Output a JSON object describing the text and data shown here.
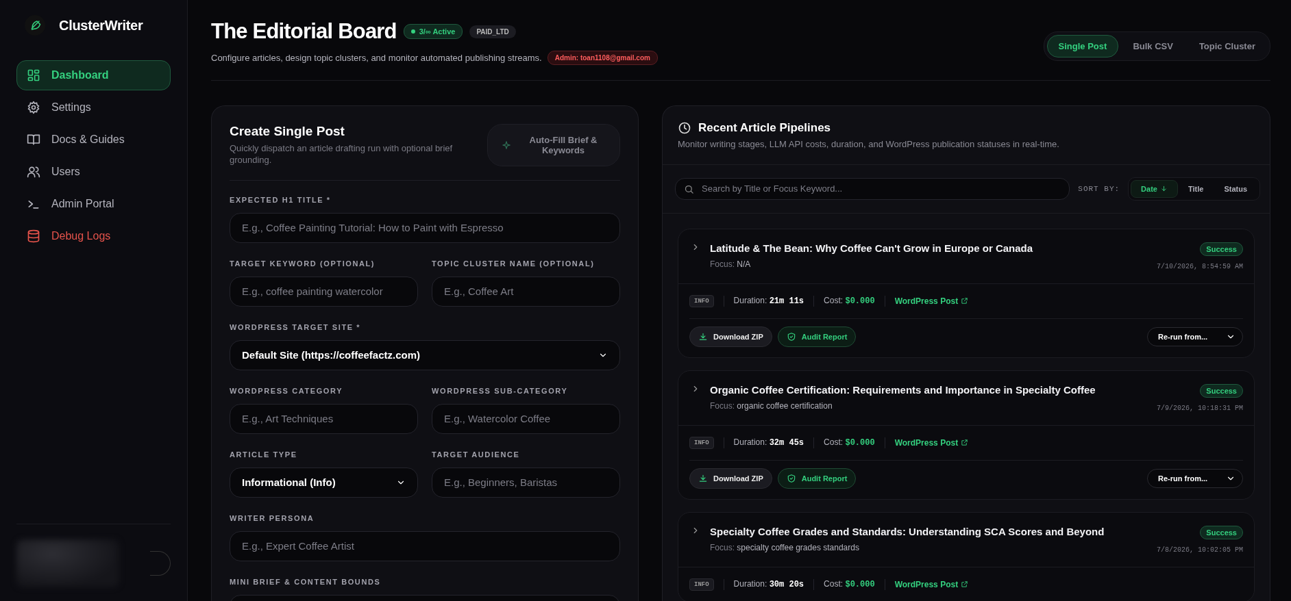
{
  "sidebar": {
    "brand": "ClusterWriter",
    "items": [
      {
        "label": "Dashboard",
        "selected": true,
        "kind": "default"
      },
      {
        "label": "Settings",
        "selected": false,
        "kind": "default"
      },
      {
        "label": "Docs & Guides",
        "selected": false,
        "kind": "default"
      },
      {
        "label": "Users",
        "selected": false,
        "kind": "default"
      },
      {
        "label": "Admin Portal",
        "selected": false,
        "kind": "default"
      },
      {
        "label": "Debug Logs",
        "selected": false,
        "kind": "danger"
      }
    ]
  },
  "header": {
    "title": "The Editorial Board",
    "status_badge": "3/∞ Active",
    "plan_badge": "PAID_LTD",
    "subtitle": "Configure articles, design topic clusters, and monitor automated publishing streams.",
    "admin_badge": "Admin: toan1108@gmail.com",
    "tabs": [
      {
        "label": "Single Post",
        "selected": true
      },
      {
        "label": "Bulk CSV",
        "selected": false
      },
      {
        "label": "Topic Cluster",
        "selected": false
      }
    ]
  },
  "create_post": {
    "title": "Create Single Post",
    "description": "Quickly dispatch an article drafting run with optional brief grounding.",
    "autofill_button": "Auto-Fill Brief & Keywords",
    "rows": [
      [
        {
          "label": "EXPECTED H1 TITLE *",
          "kind": "input",
          "placeholder": "E.g., Coffee Painting Tutorial: How to Paint with Espresso"
        }
      ],
      [
        {
          "label": "TARGET KEYWORD (OPTIONAL)",
          "kind": "input",
          "placeholder": "E.g., coffee painting watercolor"
        },
        {
          "label": "TOPIC CLUSTER NAME (OPTIONAL)",
          "kind": "input",
          "placeholder": "E.g., Coffee Art"
        }
      ],
      [
        {
          "label": "WORDPRESS TARGET SITE *",
          "kind": "select",
          "value": "Default Site (https://coffeefactz.com)"
        }
      ],
      [
        {
          "label": "WORDPRESS CATEGORY",
          "kind": "input",
          "placeholder": "E.g., Art Techniques"
        },
        {
          "label": "WORDPRESS SUB-CATEGORY",
          "kind": "input",
          "placeholder": "E.g., Watercolor Coffee"
        }
      ],
      [
        {
          "label": "ARTICLE TYPE",
          "kind": "select",
          "value": "Informational (Info)"
        },
        {
          "label": "TARGET AUDIENCE",
          "kind": "input",
          "placeholder": "E.g., Beginners, Baristas"
        }
      ],
      [
        {
          "label": "WRITER PERSONA",
          "kind": "input",
          "placeholder": "E.g., Expert Coffee Artist"
        }
      ],
      [
        {
          "label": "MINI BRIEF & CONTENT BOUNDS",
          "kind": "textarea"
        }
      ]
    ]
  },
  "pipelines": {
    "title": "Recent Article Pipelines",
    "description": "Monitor writing stages, LLM API costs, duration, and WordPress publication statuses in real-time.",
    "search_placeholder": "Search by Title or Focus Keyword...",
    "sort_label": "SORT BY:",
    "sort_options": [
      {
        "label": "Date",
        "selected": true
      },
      {
        "label": "Title",
        "selected": false
      },
      {
        "label": "Status",
        "selected": false
      }
    ],
    "items": [
      {
        "title": "Latitude & The Bean: Why Coffee Can't Grow in Europe or Canada",
        "focus_label": "Focus:",
        "focus": "N/A",
        "status": "Success",
        "timestamp": "7/10/2026, 8:54:59 AM",
        "level_tag": "INFO",
        "duration_label": "Duration:",
        "duration": "21m 11s",
        "cost_label": "Cost:",
        "cost": "$0.000",
        "link": "WordPress Post",
        "actions": {
          "download": "Download ZIP",
          "audit": "Audit Report",
          "rerun": "Re-run from..."
        }
      },
      {
        "title": "Organic Coffee Certification: Requirements and Importance in Specialty Coffee",
        "focus_label": "Focus:",
        "focus": "organic coffee certification",
        "status": "Success",
        "timestamp": "7/9/2026, 10:18:31 PM",
        "level_tag": "INFO",
        "duration_label": "Duration:",
        "duration": "32m 45s",
        "cost_label": "Cost:",
        "cost": "$0.000",
        "link": "WordPress Post",
        "actions": {
          "download": "Download ZIP",
          "audit": "Audit Report",
          "rerun": "Re-run from..."
        }
      },
      {
        "title": "Specialty Coffee Grades and Standards: Understanding SCA Scores and Beyond",
        "focus_label": "Focus:",
        "focus": "specialty coffee grades standards",
        "status": "Success",
        "timestamp": "7/8/2026, 10:02:05 PM",
        "level_tag": "INFO",
        "duration_label": "Duration:",
        "duration": "30m 20s",
        "cost_label": "Cost:",
        "cost": "$0.000",
        "link": "WordPress Post"
      }
    ]
  }
}
